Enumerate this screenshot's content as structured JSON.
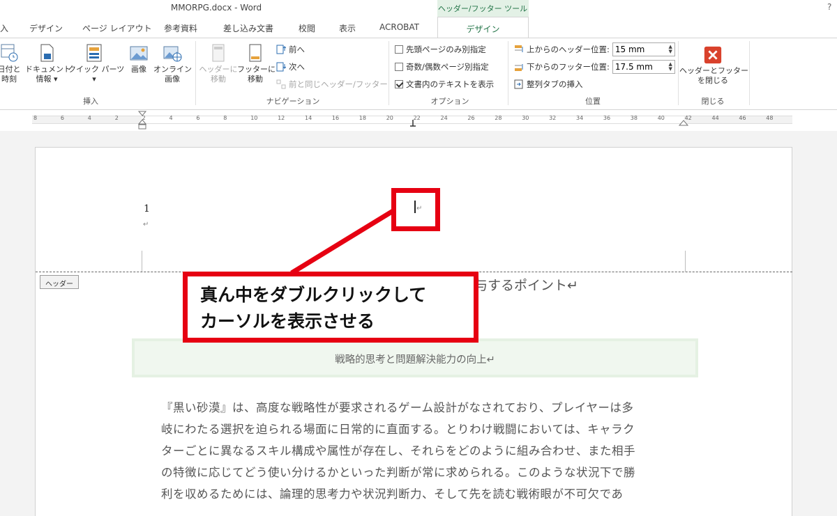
{
  "window": {
    "title": "MMORPG.docx - Word",
    "contextual_tab_group": "ヘッダー/フッター ツール",
    "help": "?"
  },
  "tabs": [
    {
      "label": "入"
    },
    {
      "label": "デザイン"
    },
    {
      "label": "ページ レイアウト"
    },
    {
      "label": "参考資料"
    },
    {
      "label": "差し込み文書"
    },
    {
      "label": "校閲"
    },
    {
      "label": "表示"
    },
    {
      "label": "ACROBAT"
    },
    {
      "label": "デザイン",
      "active": true
    }
  ],
  "ribbon": {
    "insert_group": {
      "label": "挿入",
      "buttons": [
        {
          "line1": "日付と",
          "line2": "時刻",
          "icon": "calendar-clock-icon"
        },
        {
          "line1": "ドキュメント",
          "line2": "情報 ▾",
          "icon": "document-info-icon"
        },
        {
          "line1": "クイック パーツ",
          "line2": "▾",
          "icon": "quick-parts-icon"
        },
        {
          "line1": "画像",
          "line2": "",
          "icon": "picture-icon"
        },
        {
          "line1": "オンライン",
          "line2": "画像",
          "icon": "online-picture-icon"
        }
      ]
    },
    "navigation_group": {
      "label": "ナビゲーション",
      "goto_header": {
        "line1": "ヘッダーに",
        "line2": "移動",
        "disabled": true
      },
      "goto_footer": {
        "line1": "フッターに",
        "line2": "移動"
      },
      "previous": "前へ",
      "next": "次へ",
      "link_to_previous": "前と同じヘッダー/フッター"
    },
    "options_group": {
      "label": "オプション",
      "items": [
        {
          "label": "先頭ページのみ別指定",
          "checked": false
        },
        {
          "label": "奇数/偶数ページ別指定",
          "checked": false
        },
        {
          "label": "文書内のテキストを表示",
          "checked": true
        }
      ]
    },
    "position_group": {
      "label": "位置",
      "header_position_label": "上からのヘッダー位置:",
      "header_position_value": "15 mm",
      "footer_position_label": "下からのフッター位置:",
      "footer_position_value": "17.5 mm",
      "insert_alignment_tab": "整列タブの挿入"
    },
    "close_group": {
      "label": "閉じる",
      "close_button_line1": "ヘッダーとフッター",
      "close_button_line2": "を閉じる"
    }
  },
  "ruler": {
    "labels": [
      "8",
      "6",
      "4",
      "2",
      "2",
      "4",
      "6",
      "8",
      "10",
      "12",
      "14",
      "16",
      "18",
      "20",
      "22",
      "24",
      "26",
      "28",
      "30",
      "32",
      "34",
      "36",
      "38",
      "40",
      "42",
      "44",
      "46",
      "48"
    ]
  },
  "document": {
    "header_tag": "ヘッダー",
    "header_page_number": "1",
    "paragraph_mark": "↵",
    "heading_visible_fragment": "与するポイント↵",
    "subtitle": "戦略的思考と問題解決能力の向上↵",
    "body_lines": [
      "『黒い砂漠』は、高度な戦略性が要求されるゲーム設計がなされており、プレイヤーは多",
      "岐にわたる選択を迫られる場面に日常的に直面する。とりわけ戦闘においては、キャラク",
      "ターごとに異なるスキル構成や属性が存在し、それらをどのように組み合わせ、また相手",
      "の特徴に応じてどう使い分けるかといった判断が常に求められる。このような状況下で勝",
      "利を収めるためには、論理的思考力や状況判断力、そして先を読む戦術眼が不可欠であ"
    ]
  },
  "annotation": {
    "callout_line1": "真ん中をダブルクリックして",
    "callout_line2": "カーソルを表示させる",
    "color": "#e60012"
  }
}
